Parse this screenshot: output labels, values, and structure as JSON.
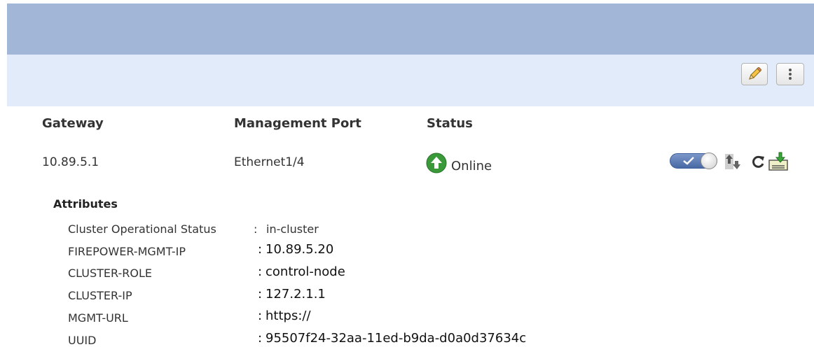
{
  "toolbar": {
    "edit_icon": "pencil-icon",
    "more_icon": "vertical-ellipsis-icon"
  },
  "columns": {
    "gateway": "Gateway",
    "management_port": "Management Port",
    "status": "Status"
  },
  "row": {
    "gateway": "10.89.5.1",
    "management_port": "Ethernet1/4",
    "status": "Online",
    "status_icon": "green-up-arrow-icon",
    "status_color": "#3a9a3a",
    "toggle_enabled": true,
    "actions": [
      "toggle-switch",
      "upgrade-icon",
      "refresh-icon",
      "download-icon"
    ]
  },
  "attributes": {
    "heading": "Attributes",
    "items": [
      {
        "name": "Cluster Operational Status",
        "sep": ":",
        "value": "in-cluster"
      },
      {
        "name": "FIREPOWER-MGMT-IP",
        "sep": ":",
        "value": "10.89.5.20"
      },
      {
        "name": "CLUSTER-ROLE",
        "sep": ":",
        "value": "control-node"
      },
      {
        "name": "CLUSTER-IP",
        "sep": ":",
        "value": "127.2.1.1"
      },
      {
        "name": "MGMT-URL",
        "sep": ":",
        "value": "https://"
      },
      {
        "name": "UUID",
        "sep": ":",
        "value": "95507f24-32aa-11ed-b9da-d0a0d37634c"
      }
    ]
  },
  "colors": {
    "header_band": "#a2b6d8",
    "toolbar_band": "#e1ebf9",
    "toggle_blue": "#4869a5"
  }
}
